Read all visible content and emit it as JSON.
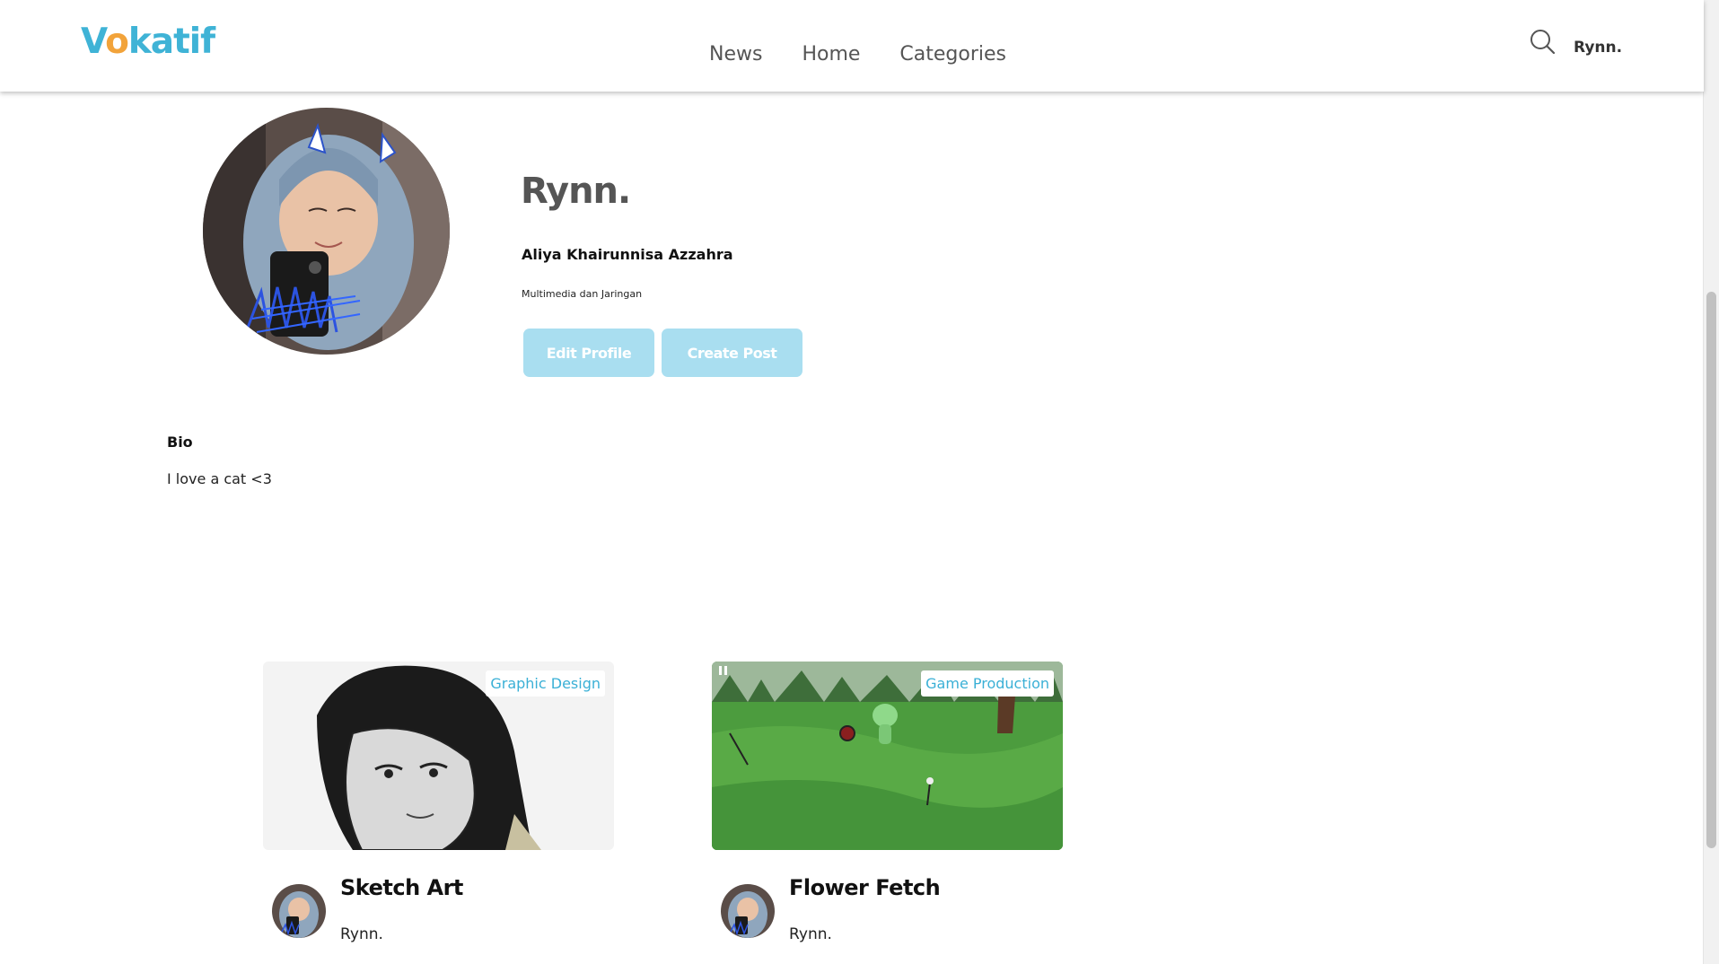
{
  "header": {
    "logo_prefix": "V",
    "logo_o": "o",
    "logo_suffix": "katif",
    "nav": [
      "News",
      "Home",
      "Categories"
    ],
    "user": "Rynn."
  },
  "profile": {
    "display_name": "Rynn.",
    "full_name": "Aliya Khairunnisa Azzahra",
    "major": "Multimedia dan Jaringan",
    "edit_button": "Edit Profile",
    "create_button": "Create Post",
    "bio_label": "Bio",
    "bio_text": "I love a cat <3"
  },
  "posts": [
    {
      "category": "Graphic Design",
      "title": "Sketch Art",
      "author": "Rynn."
    },
    {
      "category": "Game Production",
      "title": "Flower Fetch",
      "author": "Rynn."
    }
  ],
  "colors": {
    "brand_blue": "#3fb3d6",
    "brand_orange": "#f2a33a",
    "button_bg": "#a9def0"
  },
  "icons": {
    "search": "search-icon",
    "pause": "pause-icon"
  }
}
